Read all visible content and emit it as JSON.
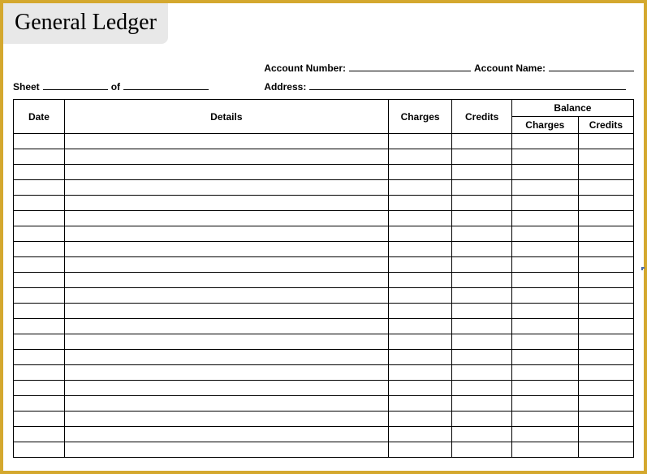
{
  "title": "General Ledger",
  "sheet": {
    "label": "Sheet",
    "of_label": "of",
    "value1": "",
    "value2": ""
  },
  "account": {
    "number_label": "Account Number:",
    "number_value": "",
    "name_label": "Account Name:",
    "name_value": "",
    "address_label": "Address:",
    "address_value": ""
  },
  "headers": {
    "date": "Date",
    "details": "Details",
    "charges": "Charges",
    "credits": "Credits",
    "balance": "Balance",
    "bal_charges": "Charges",
    "bal_credits": "Credits"
  },
  "rows": [
    {
      "date": "",
      "details": "",
      "charges": "",
      "credits": "",
      "bal_charges": "",
      "bal_credits": ""
    },
    {
      "date": "",
      "details": "",
      "charges": "",
      "credits": "",
      "bal_charges": "",
      "bal_credits": ""
    },
    {
      "date": "",
      "details": "",
      "charges": "",
      "credits": "",
      "bal_charges": "",
      "bal_credits": ""
    },
    {
      "date": "",
      "details": "",
      "charges": "",
      "credits": "",
      "bal_charges": "",
      "bal_credits": ""
    },
    {
      "date": "",
      "details": "",
      "charges": "",
      "credits": "",
      "bal_charges": "",
      "bal_credits": ""
    },
    {
      "date": "",
      "details": "",
      "charges": "",
      "credits": "",
      "bal_charges": "",
      "bal_credits": ""
    },
    {
      "date": "",
      "details": "",
      "charges": "",
      "credits": "",
      "bal_charges": "",
      "bal_credits": ""
    },
    {
      "date": "",
      "details": "",
      "charges": "",
      "credits": "",
      "bal_charges": "",
      "bal_credits": ""
    },
    {
      "date": "",
      "details": "",
      "charges": "",
      "credits": "",
      "bal_charges": "",
      "bal_credits": ""
    },
    {
      "date": "",
      "details": "",
      "charges": "",
      "credits": "",
      "bal_charges": "",
      "bal_credits": ""
    },
    {
      "date": "",
      "details": "",
      "charges": "",
      "credits": "",
      "bal_charges": "",
      "bal_credits": ""
    },
    {
      "date": "",
      "details": "",
      "charges": "",
      "credits": "",
      "bal_charges": "",
      "bal_credits": ""
    },
    {
      "date": "",
      "details": "",
      "charges": "",
      "credits": "",
      "bal_charges": "",
      "bal_credits": ""
    },
    {
      "date": "",
      "details": "",
      "charges": "",
      "credits": "",
      "bal_charges": "",
      "bal_credits": ""
    },
    {
      "date": "",
      "details": "",
      "charges": "",
      "credits": "",
      "bal_charges": "",
      "bal_credits": ""
    },
    {
      "date": "",
      "details": "",
      "charges": "",
      "credits": "",
      "bal_charges": "",
      "bal_credits": ""
    },
    {
      "date": "",
      "details": "",
      "charges": "",
      "credits": "",
      "bal_charges": "",
      "bal_credits": ""
    },
    {
      "date": "",
      "details": "",
      "charges": "",
      "credits": "",
      "bal_charges": "",
      "bal_credits": ""
    },
    {
      "date": "",
      "details": "",
      "charges": "",
      "credits": "",
      "bal_charges": "",
      "bal_credits": ""
    },
    {
      "date": "",
      "details": "",
      "charges": "",
      "credits": "",
      "bal_charges": "",
      "bal_credits": ""
    },
    {
      "date": "",
      "details": "",
      "charges": "",
      "credits": "",
      "bal_charges": "",
      "bal_credits": ""
    }
  ]
}
